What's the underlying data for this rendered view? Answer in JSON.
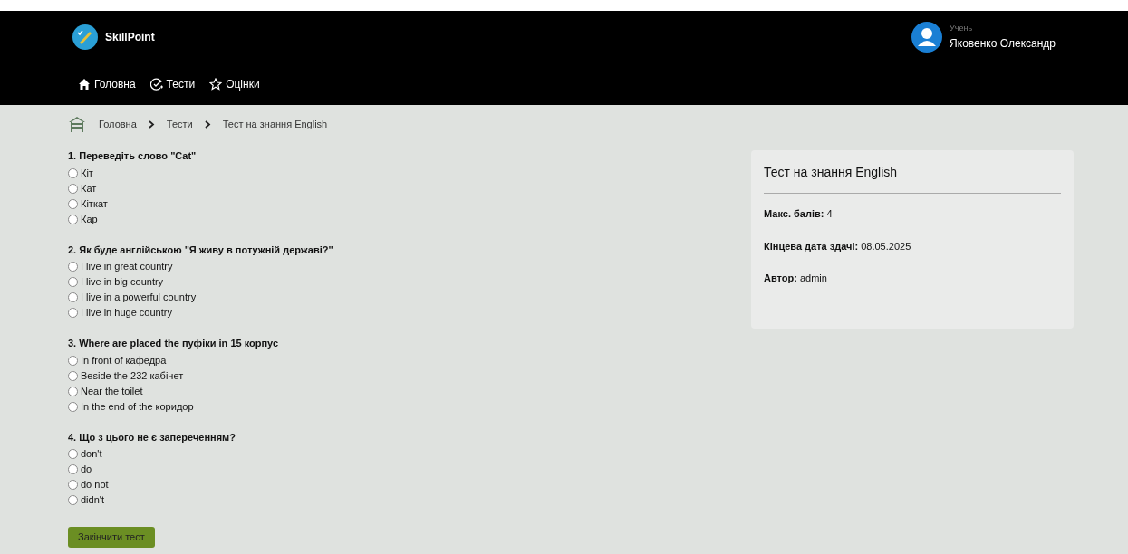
{
  "brand": {
    "name": "SkillPoint"
  },
  "user": {
    "role": "Учень",
    "name": "Яковенко Олександр"
  },
  "nav": [
    {
      "kind": "home",
      "label": "Головна"
    },
    {
      "kind": "tests",
      "label": "Тести"
    },
    {
      "kind": "grades",
      "label": "Оцінки"
    }
  ],
  "breadcrumb": [
    "Головна",
    "Тести",
    "Тест на знання English"
  ],
  "questions": [
    {
      "title": "1. Переведіть слово \"Cat\"",
      "options": [
        {
          "label": "Кіт",
          "selected": false
        },
        {
          "label": "Кат",
          "selected": false
        },
        {
          "label": "Кіткат",
          "selected": false
        },
        {
          "label": "Кар",
          "selected": false
        }
      ]
    },
    {
      "title": "2. Як буде англійською \"Я живу в потужній державі?\"",
      "options": [
        {
          "label": "I live in great country",
          "selected": false
        },
        {
          "label": "I live in big country",
          "selected": false
        },
        {
          "label": "I live in a powerful country",
          "selected": false
        },
        {
          "label": "I live in huge country",
          "selected": false
        }
      ]
    },
    {
      "title": "3. Where are placed the пуфіки in 15 корпус",
      "options": [
        {
          "label": "In front of кафедра",
          "selected": false
        },
        {
          "label": "Beside the 232 кабінет",
          "selected": false
        },
        {
          "label": "Near the toilet",
          "selected": false
        },
        {
          "label": "In the end of the коридор",
          "selected": false
        }
      ]
    },
    {
      "title": "4. Що з цього не є запереченням?",
      "options": [
        {
          "label": "don't",
          "selected": false
        },
        {
          "label": "do",
          "selected": false
        },
        {
          "label": "do not",
          "selected": false
        },
        {
          "label": "didn't",
          "selected": false
        }
      ]
    }
  ],
  "submit_button": "Закінчити тест",
  "info_card": {
    "title": "Тест на знання English",
    "fields": [
      {
        "label": "Макс. балів:",
        "value": "4"
      },
      {
        "label": "Кінцева дата здачі:",
        "value": "08.05.2025"
      },
      {
        "label": "Автор:",
        "value": "admin"
      }
    ]
  }
}
